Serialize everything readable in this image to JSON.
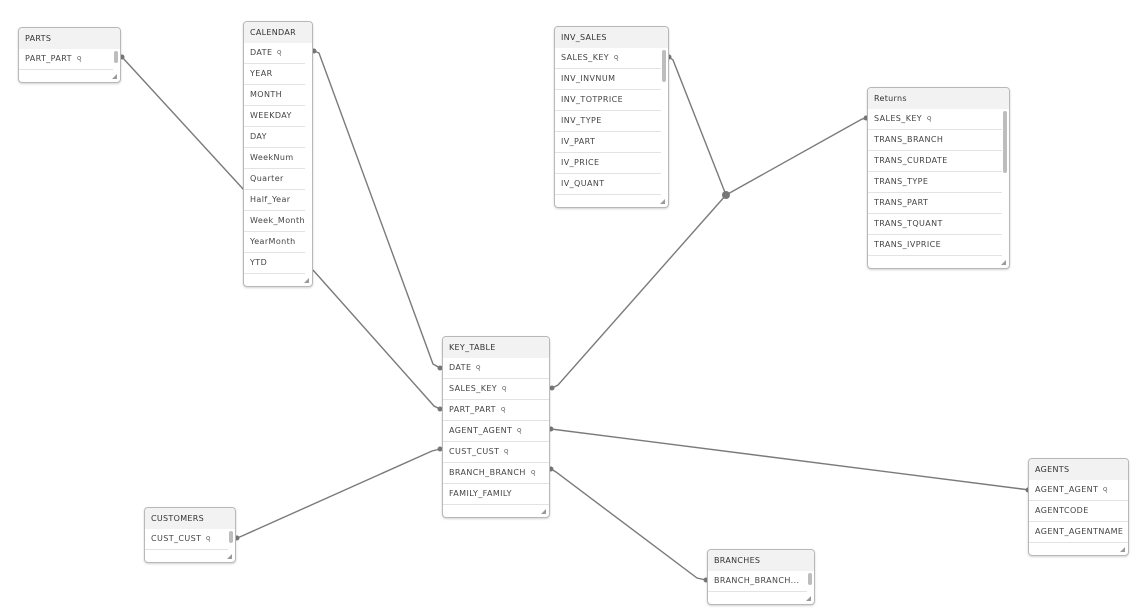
{
  "view": "Data model viewer",
  "colors": {
    "line": "#7a7a7a",
    "header_bg": "#f2f2f2",
    "border": "#b8b8b8"
  },
  "tables": {
    "parts": {
      "name": "PARTS",
      "fields": [
        {
          "label": "PART_PART",
          "key": true
        }
      ]
    },
    "calendar": {
      "name": "CALENDAR",
      "fields": [
        {
          "label": "DATE",
          "key": true
        },
        {
          "label": "YEAR"
        },
        {
          "label": "MONTH"
        },
        {
          "label": "WEEKDAY"
        },
        {
          "label": "DAY"
        },
        {
          "label": "WeekNum"
        },
        {
          "label": "Quarter"
        },
        {
          "label": "Half_Year"
        },
        {
          "label": "Week_Month"
        },
        {
          "label": "YearMonth"
        },
        {
          "label": "YTD"
        }
      ]
    },
    "inv_sales": {
      "name": "INV_SALES",
      "fields": [
        {
          "label": "SALES_KEY",
          "key": true
        },
        {
          "label": "INV_INVNUM"
        },
        {
          "label": "INV_TOTPRICE"
        },
        {
          "label": "INV_TYPE"
        },
        {
          "label": "IV_PART"
        },
        {
          "label": "IV_PRICE"
        },
        {
          "label": "IV_QUANT"
        }
      ]
    },
    "returns": {
      "name": "Returns",
      "fields": [
        {
          "label": "SALES_KEY",
          "key": true
        },
        {
          "label": "TRANS_BRANCH"
        },
        {
          "label": "TRANS_CURDATE"
        },
        {
          "label": "TRANS_TYPE"
        },
        {
          "label": "TRANS_PART"
        },
        {
          "label": "TRANS_TQUANT"
        },
        {
          "label": "TRANS_IVPRICE"
        }
      ]
    },
    "key_table": {
      "name": "KEY_TABLE",
      "fields": [
        {
          "label": "DATE",
          "key": true
        },
        {
          "label": "SALES_KEY",
          "key": true
        },
        {
          "label": "PART_PART",
          "key": true
        },
        {
          "label": "AGENT_AGENT",
          "key": true
        },
        {
          "label": "CUST_CUST",
          "key": true
        },
        {
          "label": "BRANCH_BRANCH",
          "key": true
        },
        {
          "label": "FAMILY_FAMILY"
        }
      ]
    },
    "agents": {
      "name": "AGENTS",
      "fields": [
        {
          "label": "AGENT_AGENT",
          "key": true
        },
        {
          "label": "AGENTCODE"
        },
        {
          "label": "AGENT_AGENTNAME"
        }
      ]
    },
    "customers": {
      "name": "CUSTOMERS",
      "fields": [
        {
          "label": "CUST_CUST",
          "key": true
        }
      ]
    },
    "branches": {
      "name": "BRANCHES",
      "fields": [
        {
          "label": "BRANCH_BRANCH...",
          "key": true
        }
      ]
    }
  },
  "associations": [
    {
      "from": "PARTS.PART_PART",
      "to": "KEY_TABLE.PART_PART"
    },
    {
      "from": "CALENDAR.DATE",
      "to": "KEY_TABLE.DATE"
    },
    {
      "from": "INV_SALES.SALES_KEY",
      "to": "KEY_TABLE.SALES_KEY"
    },
    {
      "from": "Returns.SALES_KEY",
      "to": "KEY_TABLE.SALES_KEY"
    },
    {
      "from": "KEY_TABLE.AGENT_AGENT",
      "to": "AGENTS.AGENT_AGENT"
    },
    {
      "from": "KEY_TABLE.CUST_CUST",
      "to": "CUSTOMERS.CUST_CUST"
    },
    {
      "from": "KEY_TABLE.BRANCH_BRANCH",
      "to": "BRANCHES.BRANCH_BRANCH"
    }
  ],
  "key_symbol": "⚲"
}
